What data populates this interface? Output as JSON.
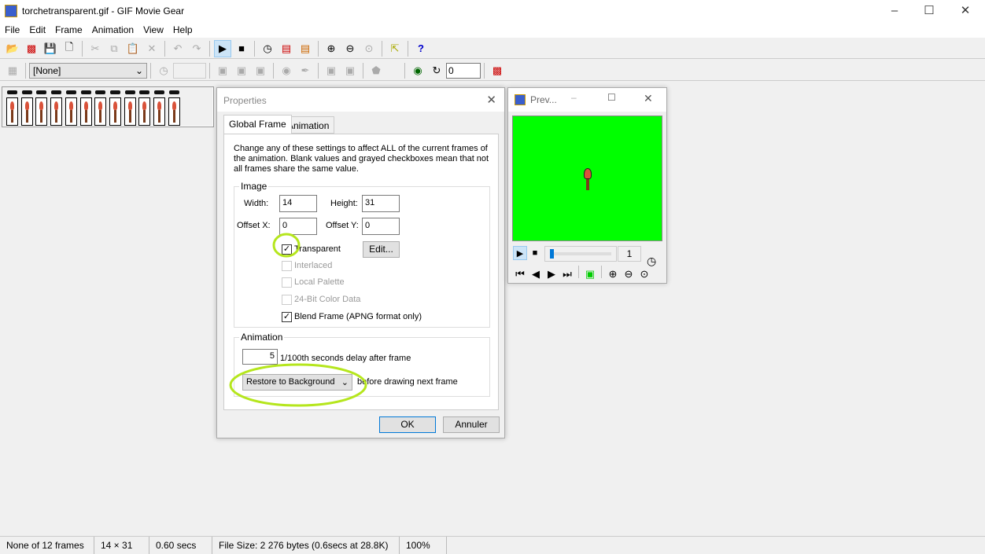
{
  "window": {
    "title": "torchetransparent.gif - GIF Movie Gear"
  },
  "menu": [
    "File",
    "Edit",
    "Frame",
    "Animation",
    "View",
    "Help"
  ],
  "toolbar2": {
    "palette_select": "[None]",
    "delay_value": "",
    "loop_value": "0"
  },
  "frames": {
    "count": 12
  },
  "properties": {
    "title": "Properties",
    "tabs": [
      "Global Frame",
      "Animation"
    ],
    "description": "Change any of these settings to affect ALL of the current frames of the animation. Blank values and grayed checkboxes mean that not all frames share the same value.",
    "image_group": "Image",
    "width_label": "Width:",
    "width": "14",
    "height_label": "Height:",
    "height": "31",
    "offx_label": "Offset X:",
    "offx": "0",
    "offy_label": "Offset Y:",
    "offy": "0",
    "transparent": "Transparent",
    "edit": "Edit...",
    "interlaced": "Interlaced",
    "local_palette": "Local Palette",
    "bit24": "24-Bit Color Data",
    "blend": "Blend Frame (APNG format only)",
    "anim_group": "Animation",
    "delay": "5",
    "delay_label": "1/100th seconds delay after frame",
    "disposal": "Restore to Background",
    "disposal_label": "before drawing next frame",
    "ok": "OK",
    "cancel": "Annuler"
  },
  "preview": {
    "title": "Prev...",
    "frame": "1",
    "bg_color": "#00ff00"
  },
  "status": {
    "frames": "None of 12 frames",
    "size": "14 × 31",
    "time": "0.60 secs",
    "file": "File Size: 2 276 bytes  (0.6secs at 28.8K)",
    "zoom": "100%"
  },
  "annotation_color": "#b5e61d"
}
